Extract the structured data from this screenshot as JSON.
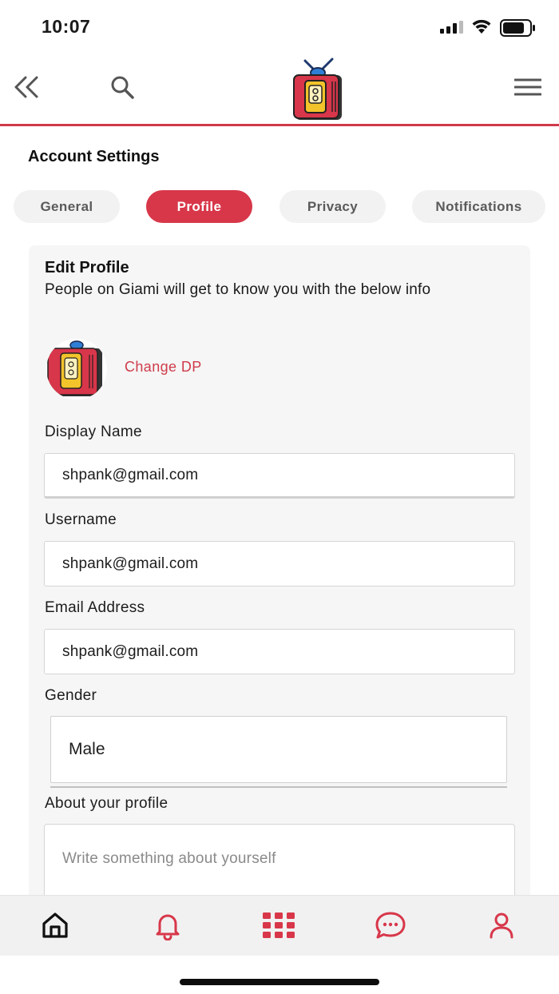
{
  "status_bar": {
    "time": "10:07"
  },
  "nav": {
    "back_icon": "double-chevron-left-icon",
    "search_icon": "search-icon",
    "logo": "tv-logo",
    "menu_icon": "hamburger-menu-icon"
  },
  "page": {
    "title": "Account Settings"
  },
  "tabs": [
    {
      "label": "General",
      "active": false
    },
    {
      "label": "Profile",
      "active": true
    },
    {
      "label": "Privacy",
      "active": false
    },
    {
      "label": "Notifications",
      "active": false
    }
  ],
  "edit_profile": {
    "title": "Edit Profile",
    "subtitle": "People on Giami will get to know you with the below info",
    "change_dp_label": "Change DP",
    "fields": {
      "display_name": {
        "label": "Display Name",
        "value": "shpank@gmail.com"
      },
      "username": {
        "label": "Username",
        "value": "shpank@gmail.com"
      },
      "email": {
        "label": "Email Address",
        "value": "shpank@gmail.com"
      },
      "gender": {
        "label": "Gender",
        "value": "Male"
      },
      "about": {
        "label": "About your profile",
        "placeholder": "Write something about yourself"
      }
    }
  },
  "bottom_bar": {
    "items": [
      "home-icon",
      "bell-icon",
      "apps-grid-icon",
      "chat-icon",
      "user-icon"
    ]
  },
  "colors": {
    "accent": "#d8374a",
    "tab_inactive_bg": "#f1f2f1",
    "card_bg": "#f5f6f5"
  }
}
